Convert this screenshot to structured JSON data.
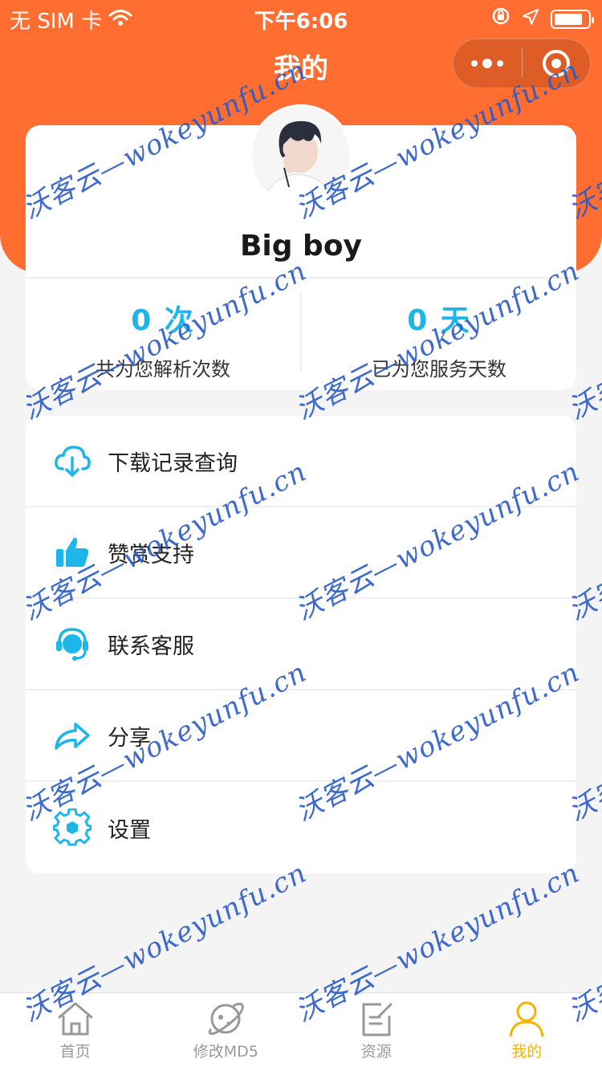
{
  "status_bar": {
    "carrier": "无 SIM 卡",
    "time": "下午6:06",
    "battery_percent": 85
  },
  "nav": {
    "title": "我的"
  },
  "profile": {
    "username": "Big boy"
  },
  "stats": [
    {
      "value": "0 次",
      "label": "共为您解析次数"
    },
    {
      "value": "0 天",
      "label": "已为您服务天数"
    }
  ],
  "menu": [
    {
      "label": "下载记录查询",
      "icon": "cloud-download-icon"
    },
    {
      "label": "赞赏支持",
      "icon": "thumbs-up-icon"
    },
    {
      "label": "联系客服",
      "icon": "headset-icon"
    },
    {
      "label": "分享",
      "icon": "share-icon"
    },
    {
      "label": "设置",
      "icon": "gear-icon"
    }
  ],
  "tabbar": [
    {
      "label": "首页",
      "icon": "home-icon",
      "active": false
    },
    {
      "label": "修改MD5",
      "icon": "planet-icon",
      "active": false
    },
    {
      "label": "资源",
      "icon": "document-edit-icon",
      "active": false
    },
    {
      "label": "我的",
      "icon": "user-icon",
      "active": true
    }
  ],
  "watermark": {
    "text": "沃客云—wokeyunfu.cn"
  },
  "colors": {
    "primary": "#ff6d30",
    "accent": "#1cb6e8",
    "active_tab": "#f5b400",
    "watermark": "#2a5ac8"
  }
}
